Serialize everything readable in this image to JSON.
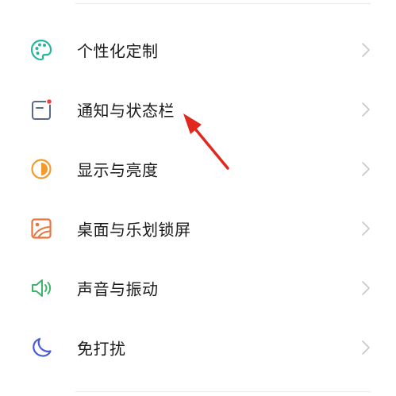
{
  "settings_list": {
    "items": [
      {
        "label": "个性化定制",
        "icon": "palette-icon"
      },
      {
        "label": "通知与状态栏",
        "icon": "notification-icon"
      },
      {
        "label": "显示与亮度",
        "icon": "brightness-icon"
      },
      {
        "label": "桌面与乐划锁屏",
        "icon": "wallpaper-icon"
      },
      {
        "label": "声音与振动",
        "icon": "speaker-icon"
      },
      {
        "label": "免打扰",
        "icon": "moon-icon"
      }
    ]
  },
  "colors": {
    "palette_icon": "#2bb5a0",
    "notification_icon": "#5a6b8a",
    "notification_dot": "#e8483f",
    "brightness_icon": "#f29a2e",
    "wallpaper_icon": "#e8743b",
    "speaker_icon": "#3fb56b",
    "moon_icon": "#4a5bd8",
    "chevron": "#c8c8c8",
    "arrow": "#e0281f"
  }
}
